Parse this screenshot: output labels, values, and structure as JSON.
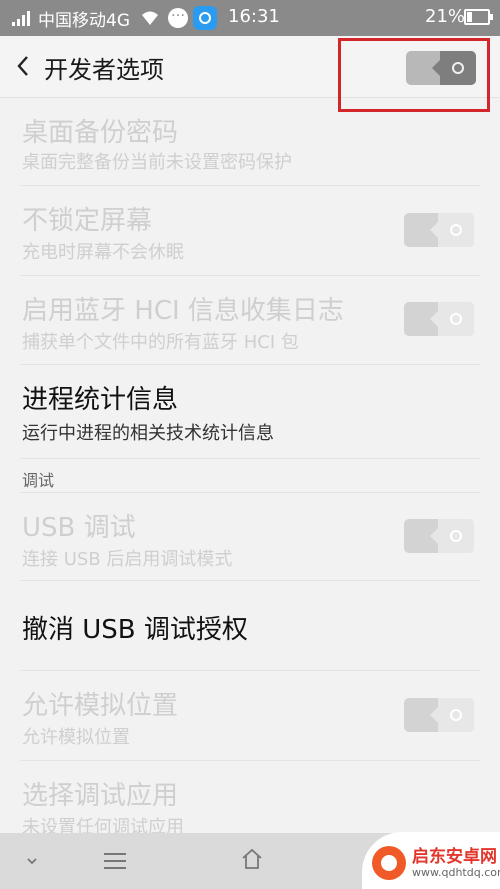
{
  "status_bar": {
    "carrier": "中国移动4G",
    "time": "16:31",
    "battery": "21%"
  },
  "header": {
    "title": "开发者选项",
    "master_toggle_on": true
  },
  "rows": [
    {
      "title": "桌面备份密码",
      "subtitle": "桌面完整备份当前未设置密码保护",
      "enabled": false,
      "has_toggle": false
    },
    {
      "title": "不锁定屏幕",
      "subtitle": "充电时屏幕不会休眠",
      "enabled": false,
      "has_toggle": true
    },
    {
      "title": "启用蓝牙 HCI 信息收集日志",
      "subtitle": "捕获单个文件中的所有蓝牙 HCI 包",
      "enabled": false,
      "has_toggle": true
    },
    {
      "title": "进程统计信息",
      "subtitle": "运行中进程的相关技术统计信息",
      "enabled": true,
      "has_toggle": false
    }
  ],
  "section_debug": "调试",
  "debug_rows": [
    {
      "title": "USB 调试",
      "subtitle": "连接 USB 后启用调试模式",
      "enabled": false,
      "has_toggle": true
    },
    {
      "title": "撤消 USB 调试授权",
      "subtitle": "",
      "enabled": true,
      "has_toggle": false
    },
    {
      "title": "允许模拟位置",
      "subtitle": "允许模拟位置",
      "enabled": false,
      "has_toggle": true
    },
    {
      "title": "选择调试应用",
      "subtitle": "未设置任何调试应用",
      "enabled": false,
      "has_toggle": false
    }
  ],
  "watermark": {
    "name": "启东安卓网",
    "url": "www.qdhtdq.com"
  },
  "colors": {
    "status_bar": "#8a8a8a",
    "highlight": "#d4262a",
    "watermark_red": "#e2352c"
  }
}
